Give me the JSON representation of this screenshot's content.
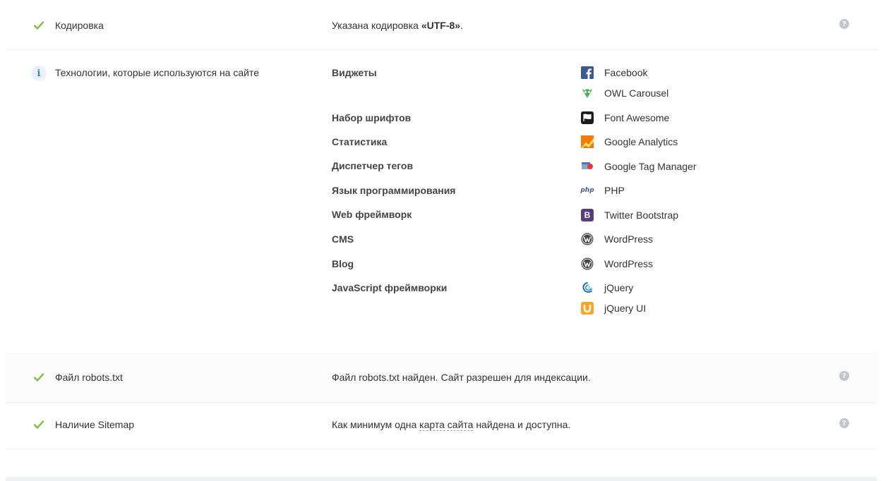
{
  "rows": {
    "encoding": {
      "label": "Кодировка",
      "desc_prefix": "Указана кодировка ",
      "desc_value": "«UTF-8»",
      "desc_suffix": ".",
      "help": "?"
    },
    "technologies": {
      "label": "Технологии, которые используются на сайте",
      "info_glyph": "i",
      "categories": [
        {
          "name": "Виджеты",
          "items": [
            {
              "name": "Facebook",
              "icon": "facebook-icon"
            },
            {
              "name": "OWL Carousel",
              "icon": "owl-carousel-icon"
            }
          ]
        },
        {
          "name": "Набор шрифтов",
          "items": [
            {
              "name": "Font Awesome",
              "icon": "font-awesome-icon"
            }
          ]
        },
        {
          "name": "Статистика",
          "items": [
            {
              "name": "Google Analytics",
              "icon": "google-analytics-icon"
            }
          ]
        },
        {
          "name": "Диспетчер тегов",
          "items": [
            {
              "name": "Google Tag Manager",
              "icon": "google-tag-manager-icon"
            }
          ]
        },
        {
          "name": "Язык программирования",
          "items": [
            {
              "name": "PHP",
              "icon": "php-icon",
              "icon_text": "php"
            }
          ]
        },
        {
          "name": "Web фреймворк",
          "items": [
            {
              "name": "Twitter Bootstrap",
              "icon": "bootstrap-icon",
              "icon_text": "B"
            }
          ]
        },
        {
          "name": "CMS",
          "items": [
            {
              "name": "WordPress",
              "icon": "wordpress-icon"
            }
          ]
        },
        {
          "name": "Blog",
          "items": [
            {
              "name": "WordPress",
              "icon": "wordpress-icon"
            }
          ]
        },
        {
          "name": "JavaScript фреймворки",
          "items": [
            {
              "name": "jQuery",
              "icon": "jquery-icon"
            },
            {
              "name": "jQuery UI",
              "icon": "jquery-ui-icon"
            }
          ]
        }
      ]
    },
    "robots": {
      "label": "Файл robots.txt",
      "desc": "Файл robots.txt найден. Сайт разрешен для индексации.",
      "help": "?"
    },
    "sitemap": {
      "label": "Наличие Sitemap",
      "desc_prefix": "Как минимум одна ",
      "desc_link": "карта сайта",
      "desc_suffix": " найдена и доступна.",
      "help": "?"
    }
  },
  "colors": {
    "check": "#7cbd3c",
    "info_bg": "#eaf2fb",
    "info_fg": "#3b82c4",
    "help_bg": "#c2c7cc",
    "facebook": "#3b5998",
    "bootstrap": "#563d7c",
    "analytics": "#f57c00",
    "jquery": "#0769ad",
    "jquery_ui": "#faa523",
    "owl": "#4caf50"
  }
}
